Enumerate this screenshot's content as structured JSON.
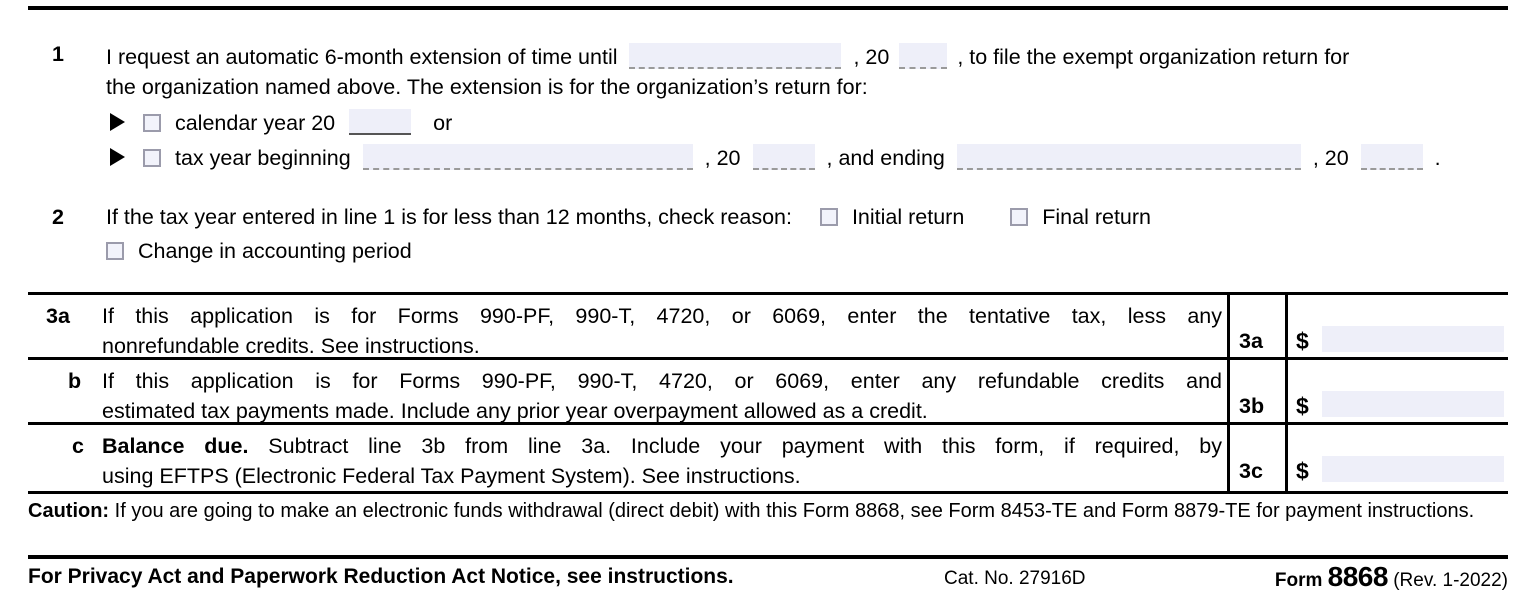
{
  "form": {
    "number": "8868",
    "form_word": "Form",
    "revision": "(Rev. 1-2022)",
    "catalog": "Cat. No. 27916D",
    "privacy_notice": "For Privacy Act and Paperwork Reduction Act Notice, see instructions."
  },
  "line1": {
    "number": "1",
    "text_a": "I request an automatic 6-month extension of time until",
    "text_b": ", 20",
    "text_c": ", to file the exempt organization return for",
    "text_d": "the organization named above. The extension is for the organization’s return for:",
    "calendar": {
      "label": "calendar year 20",
      "or": "or"
    },
    "taxyear": {
      "label": "tax year beginning",
      "comma20_1": ", 20",
      "and_ending": ", and ending",
      "comma20_2": ", 20",
      "period": "."
    }
  },
  "line2": {
    "number": "2",
    "text": "If the tax year entered in line 1 is for less than 12 months, check reason:",
    "options": [
      {
        "label": "Initial return"
      },
      {
        "label": "Final return"
      },
      {
        "label": "Change in accounting period"
      }
    ]
  },
  "line3": {
    "rows": [
      {
        "label": "3a",
        "cell_label": "3a",
        "currency": "$",
        "text_line1": "If this application is for Forms 990-PF, 990-T, 4720, or 6069, enter the tentative tax, less any",
        "text_line2": "nonrefundable credits. See instructions.",
        "bold_lead": ""
      },
      {
        "label": "b",
        "cell_label": "3b",
        "currency": "$",
        "text_line1": "If this application is for Forms 990-PF, 990-T, 4720, or 6069, enter any refundable credits and",
        "text_line2": "estimated tax payments made. Include any prior year overpayment allowed as a credit.",
        "bold_lead": ""
      },
      {
        "label": "c",
        "cell_label": "3c",
        "currency": "$",
        "text_line1": "Subtract line 3b from line 3a. Include your payment with this form, if required, by",
        "text_line2": "using EFTPS (Electronic Federal Tax Payment System). See instructions.",
        "bold_lead": "Balance due."
      }
    ]
  },
  "caution": {
    "label": "Caution:",
    "text": " If you are going to make an electronic funds withdrawal (direct debit) with this Form 8868, see Form 8453-TE and Form 8879-TE for payment instructions."
  },
  "colors": {
    "field_fill": "#eeeff9",
    "rule": "#000000",
    "checkbox_border": "#9b9bab",
    "checkbox_fill": "#f2f3fb"
  }
}
